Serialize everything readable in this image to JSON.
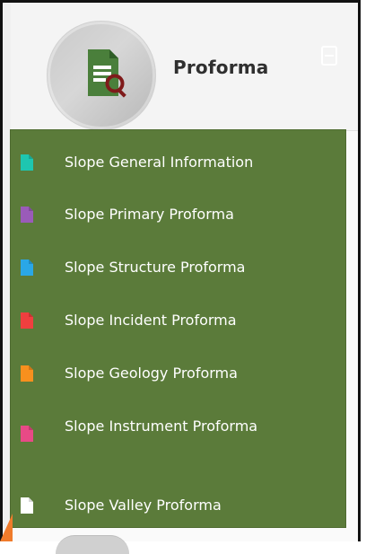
{
  "header": {
    "title": "Proforma"
  },
  "icons": {
    "document": "document-search-icon",
    "collapse": "collapse-icon"
  },
  "colors": {
    "menu_bg": "#5b7b3a"
  },
  "menu": {
    "items": [
      {
        "label": "Slope General Information",
        "icon": "file-icon",
        "icon_color": "#1ec6b0"
      },
      {
        "label": "Slope Primary Proforma",
        "icon": "file-icon",
        "icon_color": "#9a5bb9"
      },
      {
        "label": "Slope Structure Proforma",
        "icon": "file-icon",
        "icon_color": "#2aa7e6"
      },
      {
        "label": "Slope Incident Proforma",
        "icon": "file-icon",
        "icon_color": "#ef3f3f"
      },
      {
        "label": "Slope Geology Proforma",
        "icon": "file-icon",
        "icon_color": "#f7901e"
      },
      {
        "label": "Slope Instrument Proforma",
        "icon": "file-icon",
        "icon_color": "#e84a86"
      },
      {
        "label": "Slope Valley Proforma",
        "icon": "file-icon",
        "icon_color": "#ffffff"
      }
    ]
  }
}
